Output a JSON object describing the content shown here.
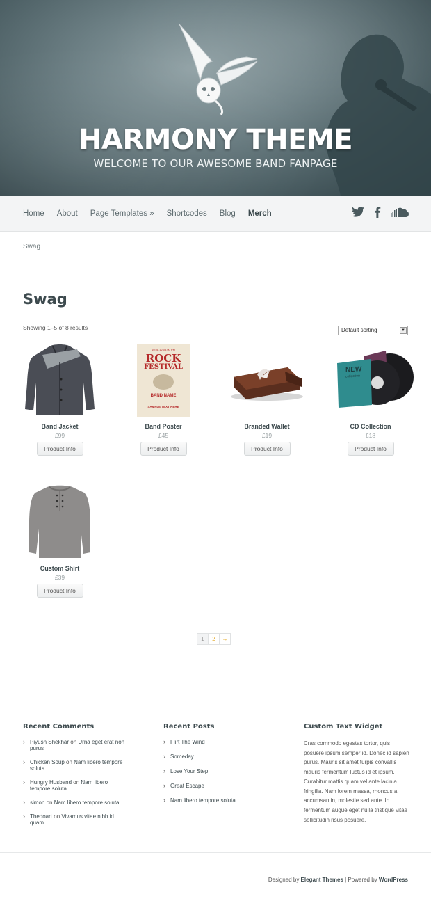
{
  "hero": {
    "title": "HARMONY THEME",
    "subtitle": "WELCOME TO OUR AWESOME BAND FANPAGE"
  },
  "nav": {
    "items": [
      {
        "label": "Home"
      },
      {
        "label": "About"
      },
      {
        "label": "Page Templates »"
      },
      {
        "label": "Shortcodes"
      },
      {
        "label": "Blog"
      },
      {
        "label": "Merch"
      }
    ],
    "social": [
      "twitter-icon",
      "facebook-icon",
      "soundcloud-icon"
    ]
  },
  "breadcrumb": "Swag",
  "main": {
    "title": "Swag",
    "result_count": "Showing 1–5 of 8 results",
    "sorting": "Default sorting",
    "products": [
      {
        "name": "Band Jacket",
        "price": "£99",
        "button": "Product Info"
      },
      {
        "name": "Band Poster",
        "price": "£45",
        "button": "Product Info"
      },
      {
        "name": "Branded Wallet",
        "price": "£19",
        "button": "Product Info"
      },
      {
        "name": "CD Collection",
        "price": "£18",
        "button": "Product Info"
      },
      {
        "name": "Custom Shirt",
        "price": "£39",
        "button": "Product Info"
      }
    ],
    "poster": {
      "date": "10.08.12 08.00 PM",
      "line1": "ROCK",
      "line2": "FESTIVAL",
      "line3": "BAND NAME",
      "line4": "SAMPLE TEXT HERE"
    },
    "cd": {
      "line1": "NEW",
      "line2": "collection"
    },
    "pagination": [
      "1",
      "2",
      "→"
    ]
  },
  "footer": {
    "recent_comments": {
      "title": "Recent Comments",
      "items": [
        {
          "author": "Piyush Shekhar",
          "on": " on ",
          "post": "Urna eget erat non purus"
        },
        {
          "author": "Chicken Soup",
          "on": " on ",
          "post": "Nam libero tempore soluta"
        },
        {
          "author": "Hungry Husband",
          "on": " on ",
          "post": "Nam libero tempore soluta"
        },
        {
          "author": "simon",
          "on": " on ",
          "post": "Nam libero tempore soluta"
        },
        {
          "author": "Thedoart",
          "on": " on ",
          "post": "Vivamus vitae nibh id quam"
        }
      ]
    },
    "recent_posts": {
      "title": "Recent Posts",
      "items": [
        "Flirt The Wind",
        "Someday",
        "Lose Your Step",
        "Great Escape",
        "Nam libero tempore soluta"
      ]
    },
    "text_widget": {
      "title": "Custom Text Widget",
      "body": "Cras commodo egestas tortor, quis posuere ipsum semper id. Donec id sapien purus. Mauris sit amet turpis convallis mauris fermentum luctus id et ipsum. Curabitur mattis quam vel ante lacinia fringilla. Nam lorem massa, rhoncus a accumsan in, molestie sed ante. In fermentum augue eget nulla tristique vitae sollicitudin risus posuere."
    },
    "credits": {
      "designed": "Designed by ",
      "elegant": "Elegant Themes",
      "sep": " | Powered by ",
      "wp": "WordPress"
    }
  }
}
